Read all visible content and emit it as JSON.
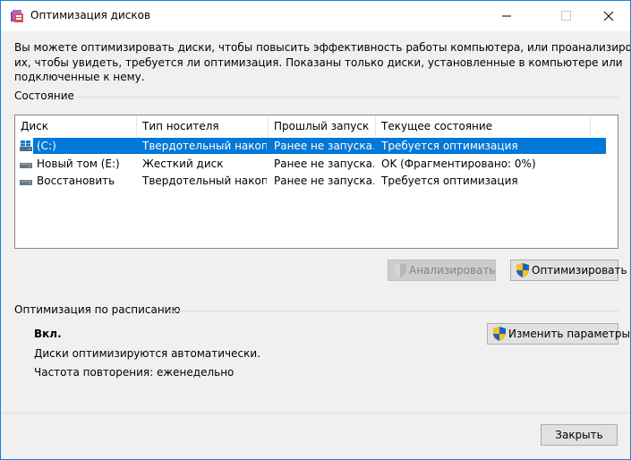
{
  "window": {
    "title": "Оптимизация дисков",
    "controls": {
      "minimize": "minimize-icon",
      "maximize": "maximize-icon",
      "close": "close-icon"
    }
  },
  "description": {
    "line1": "Вы можете оптимизировать диски, чтобы повысить эффективность работы  компьютера, или проанализировать",
    "line2": "их, чтобы увидеть, требуется ли оптимизация. Показаны только диски, установленные в компьютере или",
    "line3": "подключенные к нему."
  },
  "status_section": {
    "label": "Состояние"
  },
  "drive_list": {
    "columns": [
      "Диск",
      "Тип носителя",
      "Прошлый запуск",
      "Текущее состояние"
    ],
    "rows": [
      {
        "disk": "(C:)",
        "media": "Твердотельный накоп...",
        "last_run": "Ранее не запуска...",
        "state": "Требуется оптимизация",
        "icon": "windows-drive-icon",
        "selected": true
      },
      {
        "disk": "Новый том (E:)",
        "media": "Жесткий диск",
        "last_run": "Ранее не запуска...",
        "state": "OK (Фрагментировано: 0%)",
        "icon": "drive-icon",
        "selected": false
      },
      {
        "disk": "Восстановить",
        "media": "Твердотельный накоп...",
        "last_run": "Ранее не запуска...",
        "state": "Требуется оптимизация",
        "icon": "drive-icon",
        "selected": false
      }
    ]
  },
  "actions": {
    "analyze": "Анализировать",
    "optimize": "Оптимизировать"
  },
  "schedule": {
    "label": "Оптимизация по расписанию",
    "status": "Вкл.",
    "auto_text": "Диски оптимизируются автоматически.",
    "frequency": "Частота повторения: еженедельно",
    "change_button": "Изменить параметры"
  },
  "footer": {
    "close_button": "Закрыть"
  },
  "colors": {
    "accent": "#0078d7",
    "window_border": "#1883d7",
    "background": "#f0f0f0"
  }
}
